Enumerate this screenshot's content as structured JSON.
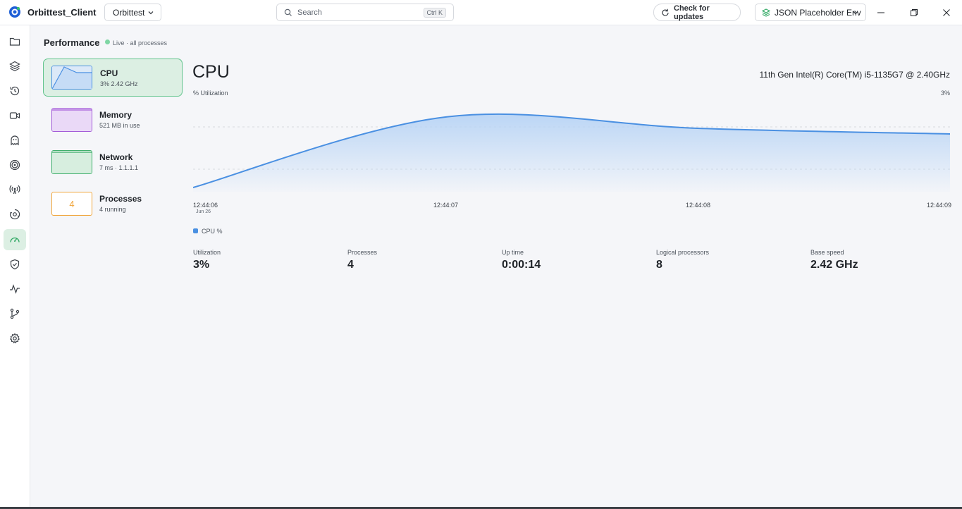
{
  "app": {
    "name": "Orbittest_Client",
    "workspace": "Orbittest"
  },
  "search": {
    "placeholder": "Search",
    "shortcut": "Ctrl K"
  },
  "toolbar": {
    "updates_label": "Check for updates",
    "environment": "JSON Placeholder Env"
  },
  "sidebar": {
    "items": [
      {
        "icon": "folder-icon",
        "active": false
      },
      {
        "icon": "layers-icon",
        "active": false
      },
      {
        "icon": "history-icon",
        "active": false
      },
      {
        "icon": "video-icon",
        "active": false
      },
      {
        "icon": "ghost-icon",
        "active": false
      },
      {
        "icon": "target-icon",
        "active": false
      },
      {
        "icon": "broadcast-icon",
        "active": false
      },
      {
        "icon": "gear-cog-icon",
        "active": false
      },
      {
        "icon": "gauge-icon",
        "active": true
      },
      {
        "icon": "shield-icon",
        "active": false
      },
      {
        "icon": "activity-icon",
        "active": false
      },
      {
        "icon": "branch-icon",
        "active": false
      },
      {
        "icon": "settings-icon",
        "active": false
      }
    ]
  },
  "performance": {
    "title": "Performance",
    "live_text": "Live · all processes",
    "resources": [
      {
        "name": "CPU",
        "sub": "3% 2.42 GHz",
        "active": true
      },
      {
        "name": "Memory",
        "sub": "521 MB in use",
        "active": false
      },
      {
        "name": "Network",
        "sub": "7 ms · 1.1.1.1",
        "active": false
      },
      {
        "name": "Processes",
        "sub": "4 running",
        "badge": "4",
        "active": false
      }
    ]
  },
  "cpu": {
    "title": "CPU",
    "model": "11th Gen Intel(R) Core(TM) i5-1135G7 @ 2.40GHz",
    "util_label": "% Utilization",
    "util_max": "3%",
    "legend": "CPU %",
    "date": "Jun 26",
    "stats": [
      {
        "label": "Utilization",
        "value": "3%"
      },
      {
        "label": "Processes",
        "value": "4"
      },
      {
        "label": "Up time",
        "value": "0:00:14"
      },
      {
        "label": "Logical processors",
        "value": "8"
      },
      {
        "label": "Base speed",
        "value": "2.42 GHz"
      }
    ]
  },
  "colors": {
    "accent_green": "#62c48d",
    "line_blue": "#4a90e2",
    "memory_purple": "#a35bd8",
    "processes_orange": "#f0a53a"
  },
  "chart_data": {
    "type": "area",
    "x": [
      "12:44:06",
      "12:44:07",
      "12:44:08",
      "12:44:09"
    ],
    "x_ticks": [
      "12:44:06",
      "12:44:07",
      "12:44:08",
      "12:44:09"
    ],
    "series": [
      {
        "name": "CPU %",
        "values": [
          0.1,
          2.6,
          2.2,
          2.0
        ]
      }
    ],
    "ylim": [
      0,
      3
    ],
    "grid": true
  }
}
